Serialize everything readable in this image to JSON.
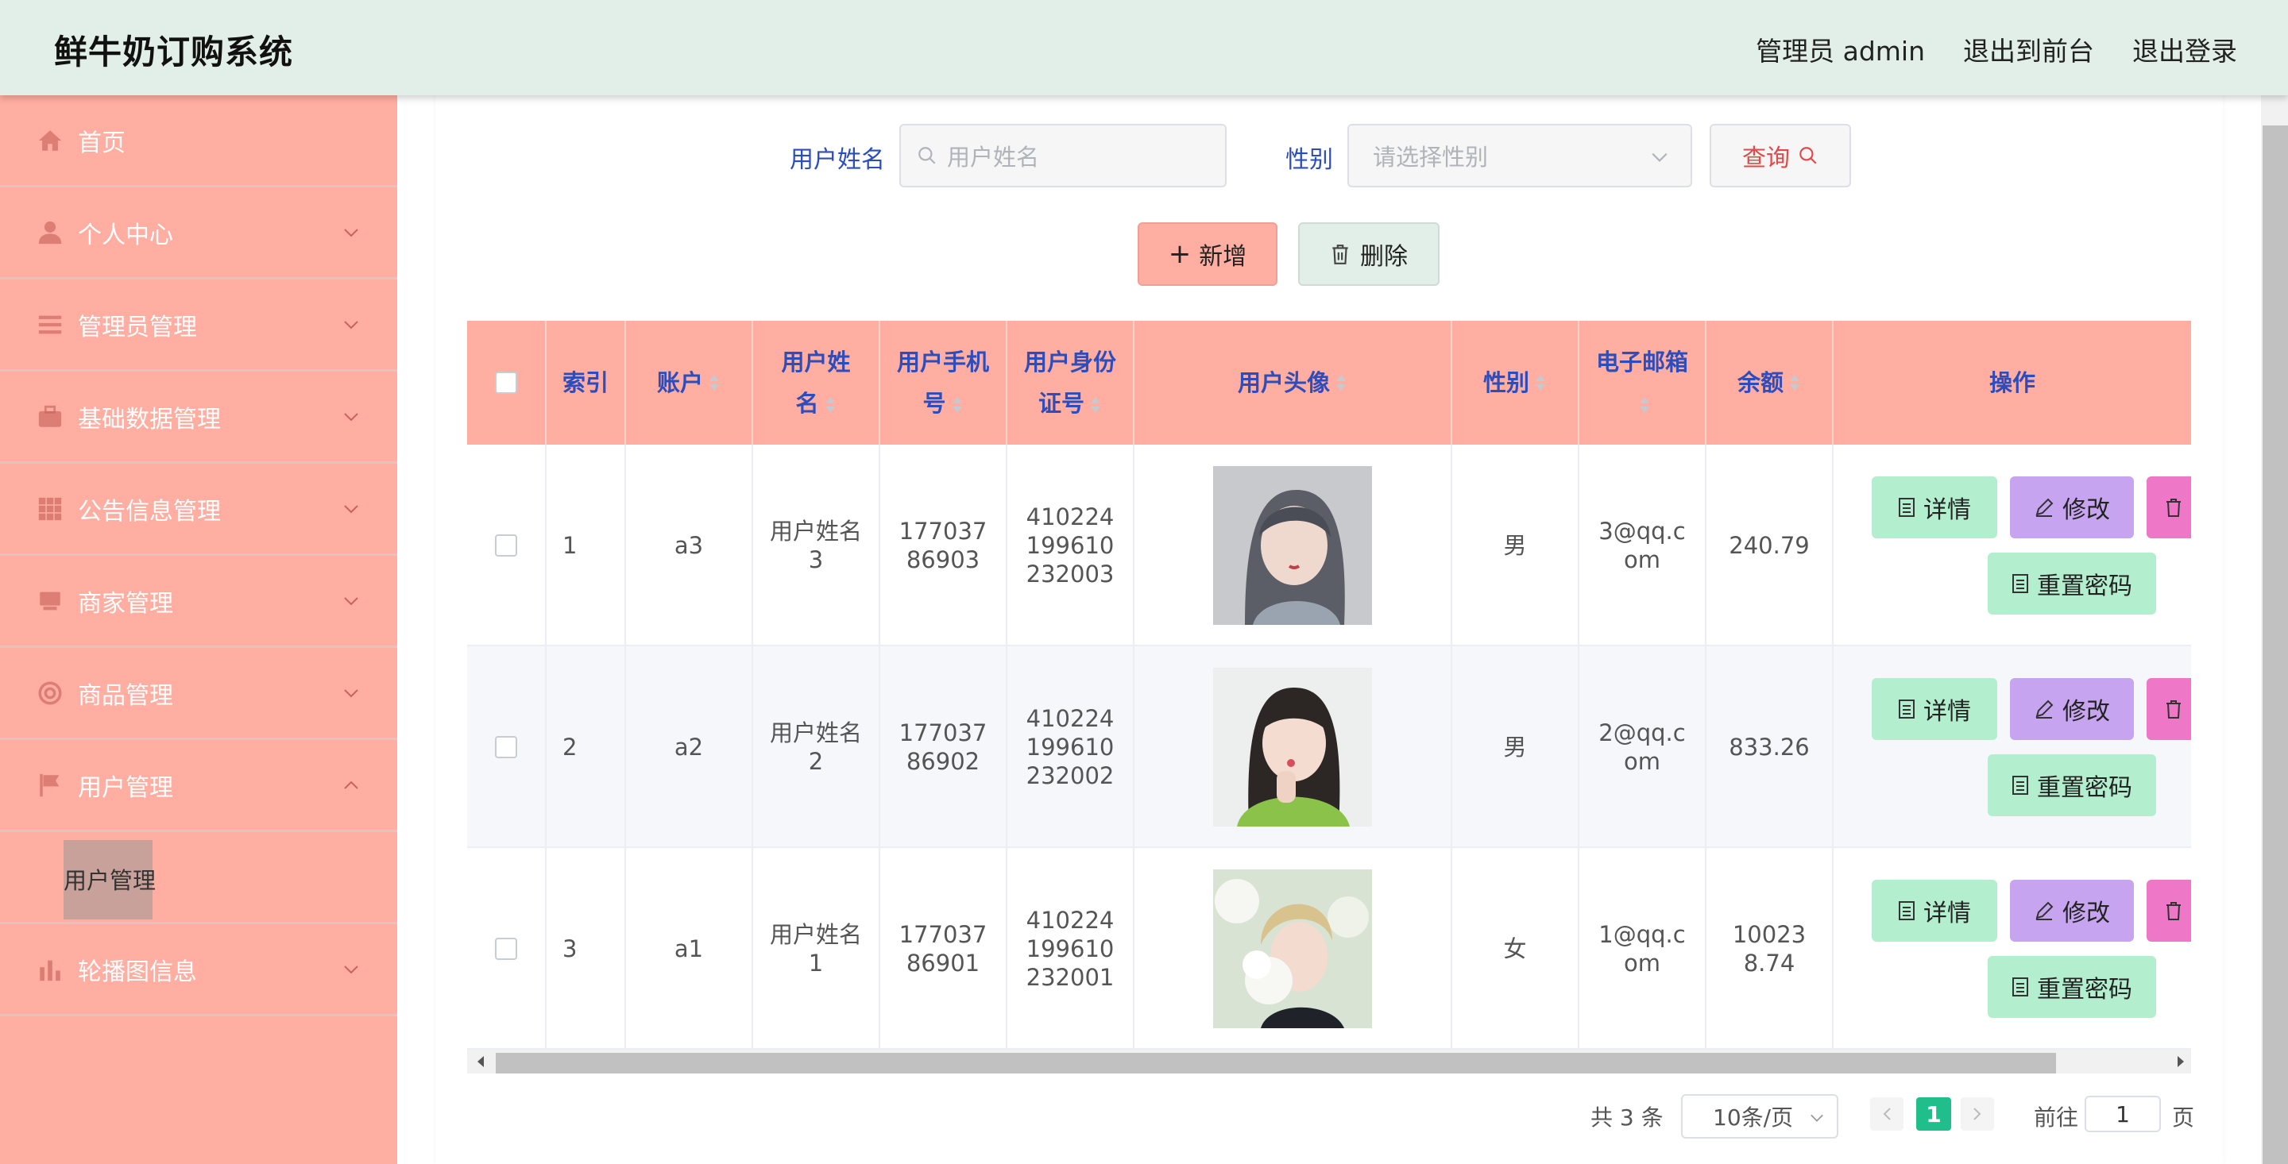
{
  "app": {
    "title": "鲜牛奶订购系统"
  },
  "header": {
    "admin_label": "管理员 admin",
    "to_front": "退出到前台",
    "logout": "退出登录"
  },
  "sidebar": {
    "items": [
      {
        "label": "首页",
        "icon": "home-icon"
      },
      {
        "label": "个人中心",
        "icon": "user-icon"
      },
      {
        "label": "管理员管理",
        "icon": "list-icon"
      },
      {
        "label": "基础数据管理",
        "icon": "briefcase-icon"
      },
      {
        "label": "公告信息管理",
        "icon": "grid-icon"
      },
      {
        "label": "商家管理",
        "icon": "store-icon"
      },
      {
        "label": "商品管理",
        "icon": "lifebuoy-icon"
      },
      {
        "label": "用户管理",
        "icon": "flag-icon"
      },
      {
        "label": "轮播图信息",
        "icon": "bar-chart-icon"
      }
    ],
    "active_sub": "用户管理"
  },
  "search": {
    "name_label": "用户姓名",
    "name_placeholder": "用户姓名",
    "gender_label": "性别",
    "gender_placeholder": "请选择性别",
    "query_label": "查询"
  },
  "actions": {
    "add_label": "新增",
    "delete_label": "删除"
  },
  "table": {
    "headers": [
      "索引",
      "账户",
      "用户姓名",
      "用户手机号",
      "用户身份证号",
      "用户头像",
      "性别",
      "电子邮箱",
      "余额",
      "操作"
    ],
    "rows": [
      {
        "index": "1",
        "account": "a3",
        "name": "用户姓名3",
        "phone": "17703786903",
        "id_card": "410224199610232003",
        "gender": "男",
        "email": "3@qq.com",
        "balance": "240.79"
      },
      {
        "index": "2",
        "account": "a2",
        "name": "用户姓名2",
        "phone": "17703786902",
        "id_card": "410224199610232002",
        "gender": "男",
        "email": "2@qq.com",
        "balance": "833.26"
      },
      {
        "index": "3",
        "account": "a1",
        "name": "用户姓名1",
        "phone": "17703786901",
        "id_card": "410224199610232001",
        "gender": "女",
        "email": "1@qq.com",
        "balance": "100238.74"
      }
    ],
    "op_labels": {
      "detail": "详情",
      "edit": "修改",
      "reset": "重置密码"
    }
  },
  "pagination": {
    "total_text": "共 3 条",
    "page_size": "10条/页",
    "current_page": "1",
    "goto_label": "前往",
    "goto_value": "1",
    "page_suffix": "页"
  },
  "colors": {
    "sidebar": "#ffaea1",
    "header": "#e2efe8",
    "table_head": "#ffaea1",
    "accent_blue": "#2d4dbd",
    "page_active": "#1fbe8a"
  }
}
